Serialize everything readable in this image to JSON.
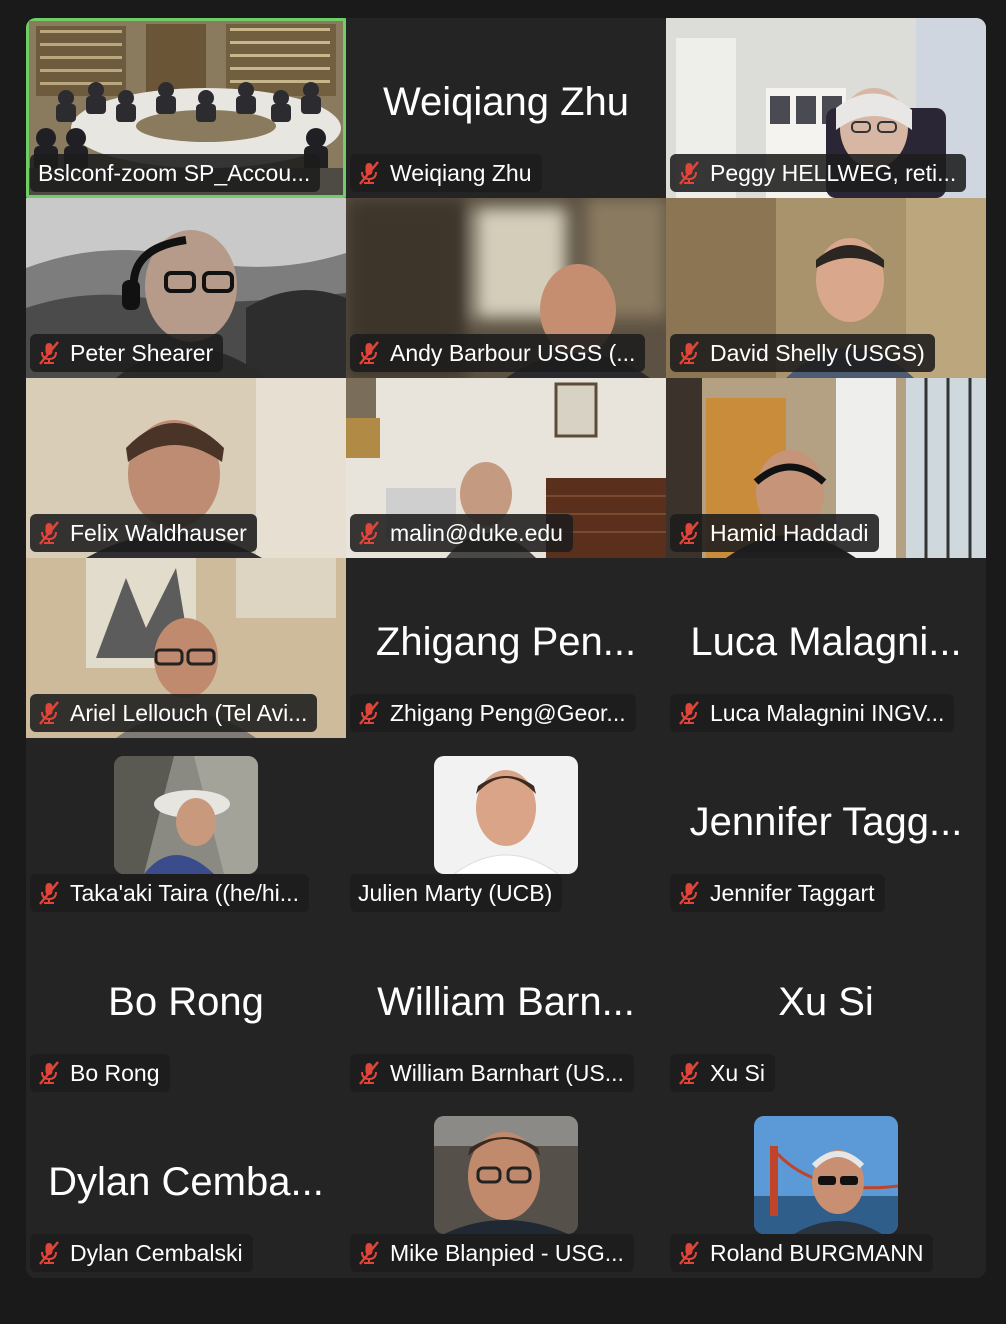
{
  "meeting": {
    "colors": {
      "active_border": "#6fcf66",
      "muted_icon": "#e0453a",
      "tile_bg": "#242424"
    },
    "tiles": [
      {
        "label": "Bslconf-zoom SP_Accou...",
        "video": "room",
        "active": true,
        "muted": false
      },
      {
        "big_name": "Weiqiang Zhu",
        "label": "Weiqiang Zhu",
        "muted": true
      },
      {
        "label": "Peggy HELLWEG, reti...",
        "video": "office-white",
        "muted": true
      },
      {
        "label": "Peter Shearer",
        "video": "hills-bw",
        "muted": true
      },
      {
        "label": "Andy Barbour USGS (...",
        "video": "blur-room",
        "muted": true
      },
      {
        "label": "David Shelly (USGS)",
        "video": "warm-room",
        "muted": true
      },
      {
        "label": "Felix Waldhauser",
        "video": "beige-wall",
        "muted": true
      },
      {
        "label": "malin@duke.edu",
        "video": "study",
        "muted": true
      },
      {
        "label": "Hamid Haddadi",
        "video": "window-office",
        "muted": true
      },
      {
        "label": "Ariel Lellouch (Tel Avi...",
        "video": "art-wall",
        "muted": true
      },
      {
        "big_name": "Zhigang Pen...",
        "label": "Zhigang Peng@Geor...",
        "muted": true
      },
      {
        "big_name": "Luca Malagni...",
        "label": "Luca Malagnini INGV...",
        "muted": true
      },
      {
        "label": "Taka'aki Taira ((he/hi...",
        "avatar": "hiker",
        "muted": true
      },
      {
        "label": "Julien Marty (UCB)",
        "avatar": "portrait-white",
        "muted": false
      },
      {
        "big_name": "Jennifer Tagg...",
        "label": "Jennifer Taggart",
        "muted": true
      },
      {
        "big_name": "Bo Rong",
        "label": "Bo Rong",
        "muted": true
      },
      {
        "big_name": "William Barn...",
        "label": "William Barnhart (US...",
        "muted": true
      },
      {
        "big_name": "Xu Si",
        "label": "Xu Si",
        "muted": true
      },
      {
        "big_name": "Dylan Cemba...",
        "label": "Dylan Cembalski",
        "muted": true
      },
      {
        "label": "Mike Blanpied - USG...",
        "avatar": "glasses-man",
        "muted": true
      },
      {
        "label": "Roland BURGMANN",
        "avatar": "bridge",
        "muted": true
      }
    ]
  }
}
